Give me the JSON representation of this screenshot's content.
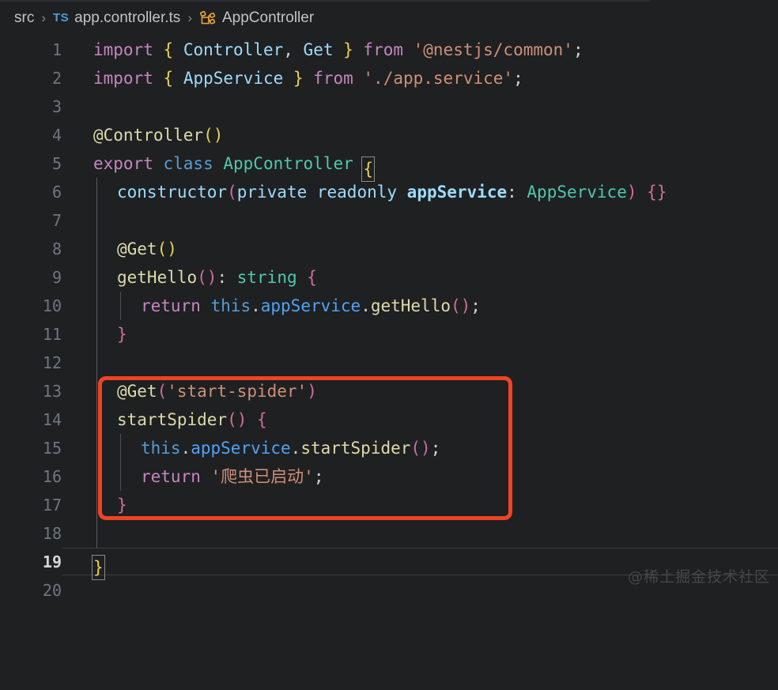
{
  "breadcrumb": {
    "folder": "src",
    "file": "app.controller.ts",
    "symbol": "AppController",
    "file_icon": "typescript-file-icon",
    "file_icon_label": "TS",
    "symbol_icon": "class-symbol-icon",
    "separator": "›"
  },
  "editor": {
    "language": "typescript",
    "active_line": 19,
    "colors": {
      "background": "#1f2022",
      "line_number": "#6e7681",
      "active_line_number": "#d6d6d6",
      "keyword": "#c586c0",
      "brace_yellow": "#e8d44d",
      "identifier": "#9cdcfe",
      "type_name": "#4ec9b0",
      "string": "#ce9178",
      "function": "#dcdcaa",
      "paren_magenta": "#d16d9e",
      "annotation_red": "#ef4423",
      "indent_guide": "#5a5c60"
    },
    "lines": [
      {
        "n": "1",
        "text": "import { Controller, Get } from '@nestjs/common';"
      },
      {
        "n": "2",
        "text": "import { AppService } from './app.service';"
      },
      {
        "n": "3",
        "text": ""
      },
      {
        "n": "4",
        "text": "@Controller()"
      },
      {
        "n": "5",
        "text": "export class AppController {"
      },
      {
        "n": "6",
        "text": "  constructor(private readonly appService: AppService) {}"
      },
      {
        "n": "7",
        "text": ""
      },
      {
        "n": "8",
        "text": "  @Get()"
      },
      {
        "n": "9",
        "text": "  getHello(): string {"
      },
      {
        "n": "10",
        "text": "    return this.appService.getHello();"
      },
      {
        "n": "11",
        "text": "  }"
      },
      {
        "n": "12",
        "text": ""
      },
      {
        "n": "13",
        "text": "  @Get('start-spider')"
      },
      {
        "n": "14",
        "text": "  startSpider() {"
      },
      {
        "n": "15",
        "text": "    this.appService.startSpider();"
      },
      {
        "n": "16",
        "text": "    return '爬虫已启动';"
      },
      {
        "n": "17",
        "text": "  }"
      },
      {
        "n": "18",
        "text": ""
      },
      {
        "n": "19",
        "text": "}"
      },
      {
        "n": "20",
        "text": ""
      }
    ],
    "tokens": {
      "l1": {
        "import": "import",
        "brace_open": "{",
        "controller": " Controller",
        "comma": ",",
        "get": " Get ",
        "brace_close": "}",
        "from": " from ",
        "module": "'@nestjs/common'",
        "semi": ";"
      },
      "l2": {
        "import": "import",
        "brace_open": "{",
        "appservice": " AppService ",
        "brace_close": "}",
        "from": " from ",
        "module": "'./app.service'",
        "semi": ";"
      },
      "l4": {
        "decorator": "@Controller",
        "parens": "()"
      },
      "l5": {
        "export": "export",
        "class": " class ",
        "name": "AppController",
        "space": " ",
        "brace": "{"
      },
      "l6": {
        "ctor": "constructor",
        "lparen": "(",
        "modifiers": "private readonly ",
        "param": "appService",
        "colon": ": ",
        "type": "AppService",
        "rparen": ")",
        "body": " {}"
      },
      "l8": {
        "decorator": "@Get",
        "parens": "()"
      },
      "l9": {
        "name": "getHello",
        "parens": "()",
        "colon": ": ",
        "type": "string",
        "brace": " {"
      },
      "l10": {
        "return": "return ",
        "this": "this",
        "dot1": ".",
        "prop": "appService",
        "dot2": ".",
        "method": "getHello",
        "parens": "()",
        "semi": ";"
      },
      "l11": {
        "brace": "}"
      },
      "l13": {
        "decorator": "@Get",
        "lparen": "(",
        "arg": "'start-spider'",
        "rparen": ")"
      },
      "l14": {
        "name": "startSpider",
        "parens": "()",
        "brace": " {"
      },
      "l15": {
        "this": "this",
        "dot1": ".",
        "prop": "appService",
        "dot2": ".",
        "method": "startSpider",
        "parens": "()",
        "semi": ";"
      },
      "l16": {
        "return": "return ",
        "str": "'爬虫已启动'",
        "semi": ";"
      },
      "l17": {
        "brace": "}"
      },
      "l19": {
        "brace": "}"
      }
    }
  },
  "annotation": {
    "type": "red-rectangle-highlight",
    "covers_lines": "13-17"
  },
  "watermark": {
    "text": "@稀土掘金技术社区"
  }
}
